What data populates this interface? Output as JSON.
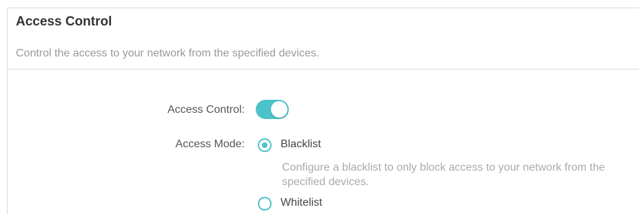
{
  "section": {
    "title": "Access Control",
    "description": "Control the access to your network from the specified devices."
  },
  "settings": {
    "access_control_label": "Access Control:",
    "access_control_enabled": true,
    "access_mode_label": "Access Mode:",
    "options": [
      {
        "label": "Blacklist",
        "selected": true,
        "description": "Configure a blacklist to only block access to your network from the specified devices."
      },
      {
        "label": "Whitelist",
        "selected": false
      }
    ]
  },
  "colors": {
    "accent": "#4cc3c9",
    "title": "#333333",
    "muted": "#999999",
    "divider": "#d9d9d9"
  }
}
